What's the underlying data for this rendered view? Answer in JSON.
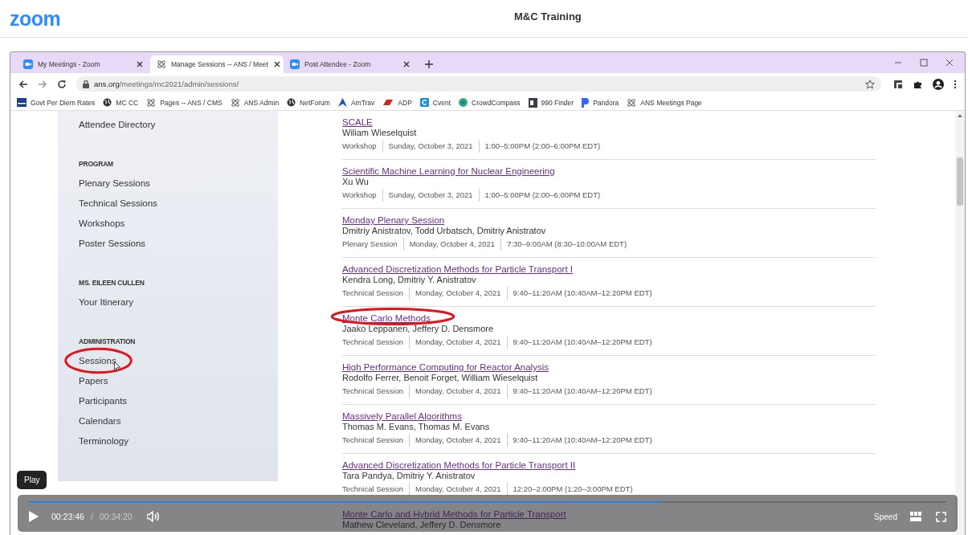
{
  "app": {
    "logo": "zoom",
    "title": "M&C Training"
  },
  "browser": {
    "tabs": [
      {
        "label": "My Meetings - Zoom",
        "kind": "zoom",
        "selected": false
      },
      {
        "label": "Manage Sessions -- ANS / Meet",
        "kind": "ans",
        "selected": true
      },
      {
        "label": "Post Attendee - Zoom",
        "kind": "zoom",
        "selected": false
      }
    ],
    "url": {
      "domain": "ans.org",
      "path": "/meetings/mc2021/admin/sessions/"
    },
    "bookmarks": [
      {
        "label": "Govt Per Diem Rates",
        "kind": "gsa"
      },
      {
        "label": "MC CC",
        "kind": "globe"
      },
      {
        "label": "Pages -- ANS / CMS",
        "kind": "ans"
      },
      {
        "label": "ANS Admin",
        "kind": "ans"
      },
      {
        "label": "NetForum",
        "kind": "globe"
      },
      {
        "label": "AmTrav",
        "kind": "peak"
      },
      {
        "label": "ADP",
        "kind": "adp"
      },
      {
        "label": "Cvent",
        "kind": "cvent"
      },
      {
        "label": "CrowdCompass",
        "kind": "compass"
      },
      {
        "label": "990 Finder",
        "kind": "finder"
      },
      {
        "label": "Pandora",
        "kind": "pandora"
      },
      {
        "label": "ANS Meetings Page",
        "kind": "ans"
      }
    ]
  },
  "sidebar": {
    "sections": [
      {
        "items": [
          {
            "label": "Attendee Directory",
            "circled": false,
            "cursor": false
          }
        ]
      },
      {
        "heading": "PROGRAM",
        "items": [
          {
            "label": "Plenary Sessions",
            "circled": false,
            "cursor": false
          },
          {
            "label": "Technical Sessions",
            "circled": false,
            "cursor": false
          },
          {
            "label": "Workshops",
            "circled": false,
            "cursor": false
          },
          {
            "label": "Poster Sessions",
            "circled": false,
            "cursor": false
          }
        ]
      },
      {
        "heading": "MS. EILEEN CULLEN",
        "items": [
          {
            "label": "Your Itinerary",
            "circled": false,
            "cursor": false
          }
        ]
      },
      {
        "heading": "ADMINISTRATION",
        "items": [
          {
            "label": "Sessions",
            "circled": true,
            "cursor": true
          },
          {
            "label": "Papers",
            "circled": false,
            "cursor": false
          },
          {
            "label": "Participants",
            "circled": false,
            "cursor": false
          },
          {
            "label": "Calendars",
            "circled": false,
            "cursor": false
          },
          {
            "label": "Terminology",
            "circled": false,
            "cursor": false
          }
        ]
      }
    ]
  },
  "sessions": [
    {
      "title": "SCALE",
      "presenters": "Wiliam Wieselquist",
      "type": "Workshop",
      "date": "Sunday, October 3, 2021",
      "time": "1:00–5:00PM (2:00–6:00PM EDT)",
      "circled": false
    },
    {
      "title": "Scientific Machine Learning for Nuclear Engineering",
      "presenters": "Xu Wu",
      "type": "Workshop",
      "date": "Sunday, October 3, 2021",
      "time": "1:00–5:00PM (2:00–6:00PM EDT)",
      "circled": false
    },
    {
      "title": "Monday Plenary Session",
      "presenters": "Dmitriy Anistratov, Todd Urbatsch, Dmitriy Anistratov",
      "type": "Plenary Session",
      "date": "Monday, October 4, 2021",
      "time": "7:30–9:00AM (8:30–10:00AM EDT)",
      "circled": false
    },
    {
      "title": "Advanced Discretization Methods for Particle Transport I",
      "presenters": "Kendra Long, Dmitriy Y. Anistratov",
      "type": "Technical Session",
      "date": "Monday, October 4, 2021",
      "time": "9:40–11:20AM (10:40AM–12:20PM EDT)",
      "circled": false
    },
    {
      "title": "Monte Carlo Methods",
      "presenters": "Jaako Leppanen, Jeffery D. Densmore",
      "type": "Technical Session",
      "date": "Monday, October 4, 2021",
      "time": "9:40–11:20AM (10:40AM–12:20PM EDT)",
      "circled": true
    },
    {
      "title": "High Performance Computing for Reactor Analysis",
      "presenters": "Rodolfo Ferrer, Benoit Forget, William Wieselquist",
      "type": "Technical Session",
      "date": "Monday, October 4, 2021",
      "time": "9:40–11:20AM (10:40AM–12:20PM EDT)",
      "circled": false
    },
    {
      "title": "Massively Parallel Algorithms",
      "presenters": "Thomas M. Evans, Thomas M. Evans",
      "type": "Technical Session",
      "date": "Monday, October 4, 2021",
      "time": "9:40–11:20AM (10:40AM–12:20PM EDT)",
      "circled": false
    },
    {
      "title": "Advanced Discretization Methods for Particle Transport II",
      "presenters": "Tara Pandya, Dmitriy Y. Anistratov",
      "type": "Technical Session",
      "date": "Monday, October 4, 2021",
      "time": "12:20–2:00PM (1:20–3:00PM EDT)",
      "circled": false
    },
    {
      "title": "Monte Carlo and Hybrid Methods for Particle Transport",
      "presenters": "Mathew Cleveland, Jeffery D. Densmore",
      "circled": false
    }
  ],
  "player": {
    "tooltip": "Play",
    "level": 0.69,
    "elapsed": "00:23:46",
    "separator": "/",
    "duration": "00:34:20",
    "speed": "Speed"
  }
}
